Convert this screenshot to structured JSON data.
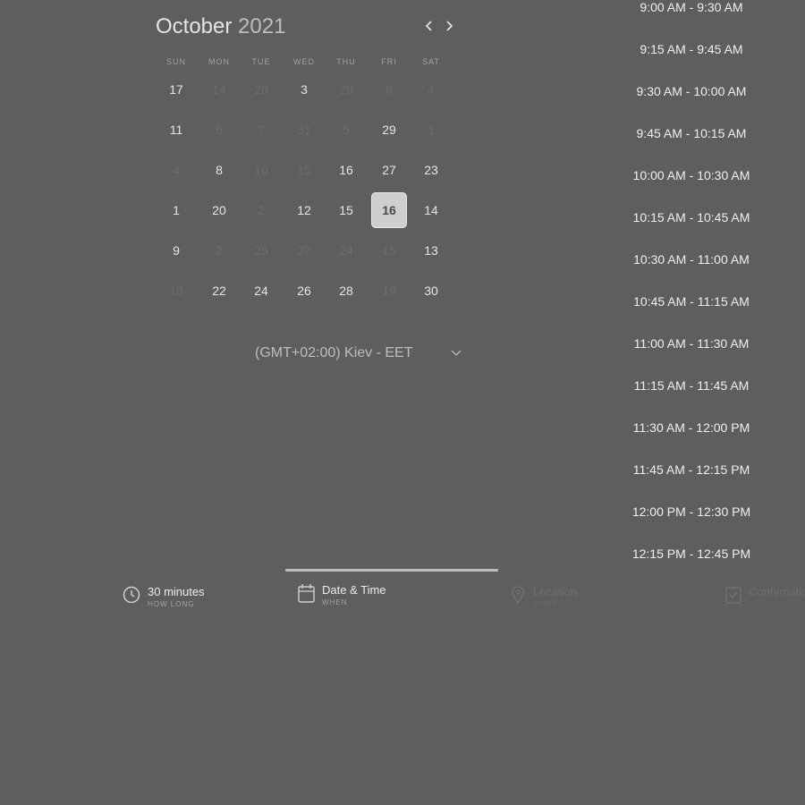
{
  "calendar": {
    "month": "October",
    "year": "2021",
    "weekdays": [
      "SUN",
      "MON",
      "TUE",
      "WED",
      "THU",
      "FRI",
      "SAT"
    ],
    "rows": [
      [
        "17",
        "14",
        "28",
        "3",
        "20",
        "8",
        "4"
      ],
      [
        "11",
        "6",
        "7",
        "31",
        "5",
        "29",
        "1"
      ],
      [
        "4",
        "8",
        "10",
        "15",
        "16",
        "27",
        "23"
      ],
      [
        "1",
        "20",
        "2",
        "12",
        "15",
        "16",
        "14"
      ],
      [
        "9",
        "2",
        "25",
        "27",
        "24",
        "15",
        "13"
      ],
      [
        "10",
        "22",
        "24",
        "26",
        "28",
        "19",
        "30"
      ]
    ],
    "muted": [
      [
        false,
        true,
        true,
        false,
        true,
        true,
        true
      ],
      [
        false,
        true,
        true,
        true,
        true,
        false,
        true
      ],
      [
        true,
        false,
        true,
        true,
        false,
        false,
        false
      ],
      [
        false,
        false,
        true,
        false,
        false,
        false,
        false
      ],
      [
        false,
        true,
        true,
        true,
        true,
        true,
        false
      ],
      [
        true,
        false,
        false,
        false,
        false,
        true,
        false
      ]
    ],
    "selected": {
      "row": 3,
      "col": 5
    }
  },
  "timezone": {
    "label": "(GMT+02:00) Kiev - EET"
  },
  "slots": [
    "9:00 AM - 9:30 AM",
    "9:15 AM - 9:45 AM",
    "9:30 AM - 10:00 AM",
    "9:45 AM - 10:15 AM",
    "10:00 AM - 10:30 AM",
    "10:15 AM - 10:45 AM",
    "10:30 AM - 11:00 AM",
    "10:45 AM - 11:15 AM",
    "11:00 AM - 11:30 AM",
    "11:15 AM - 11:45 AM",
    "11:30 AM - 12:00 PM",
    "11:45 AM - 12:15 PM",
    "12:00 PM - 12:30 PM",
    "12:15 PM - 12:45 PM"
  ],
  "steps": [
    {
      "title": "30 minutes",
      "subtitle": "HOW LONG",
      "icon": "clock-icon"
    },
    {
      "title": "Date & Time",
      "subtitle": "WHEN",
      "icon": "calendar-icon"
    },
    {
      "title": "Location",
      "subtitle": "WHERE",
      "icon": "location-pin-icon"
    },
    {
      "title": "Confirmation",
      "subtitle": "YOU",
      "icon": "confirmation-icon"
    }
  ]
}
